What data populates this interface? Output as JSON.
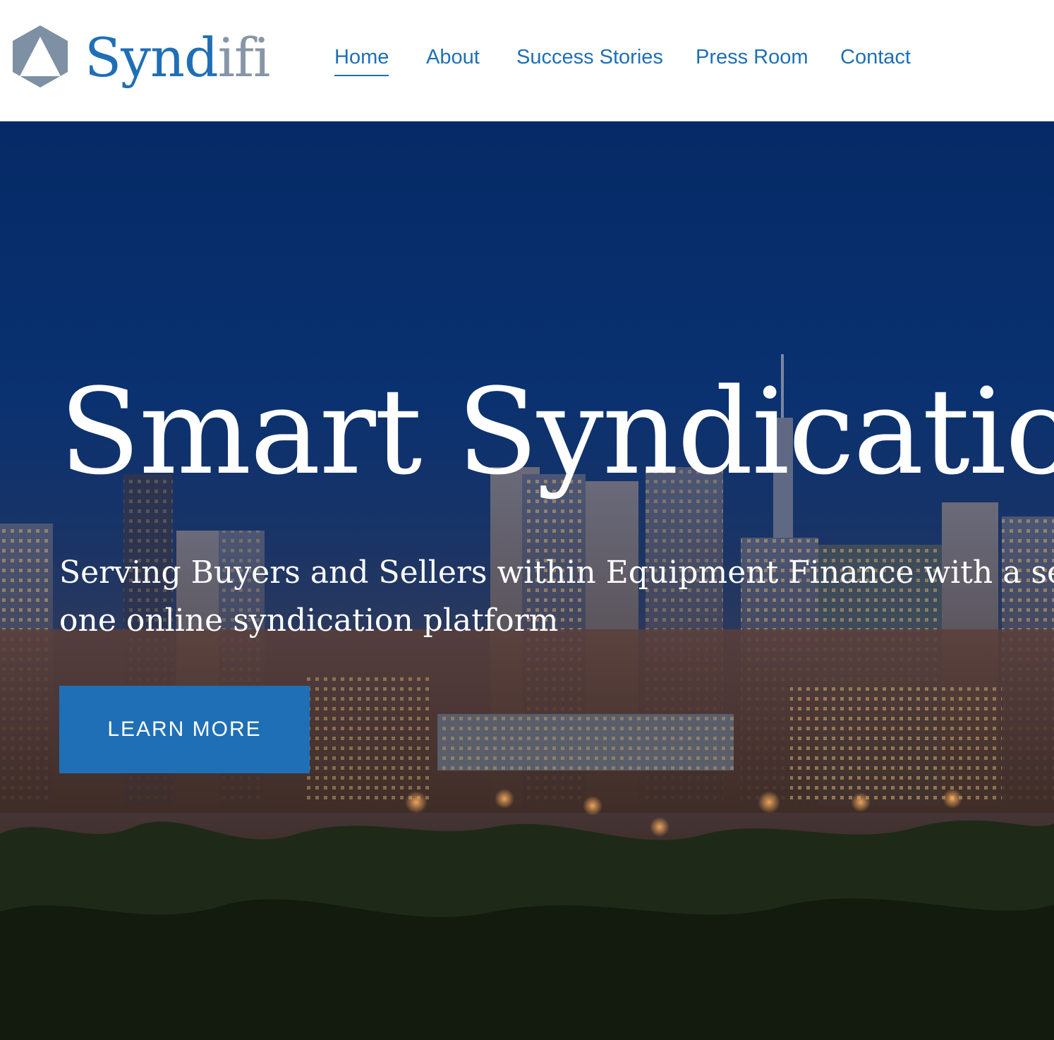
{
  "brand": {
    "name_part1": "Synd",
    "name_part2": "ifi",
    "logo_icon": "hexagon-triangle-logo-icon",
    "colors": {
      "primary": "#1f6fb6",
      "secondary": "#8796a6"
    }
  },
  "nav": {
    "items": [
      {
        "label": "Home",
        "active": true
      },
      {
        "label": "About"
      },
      {
        "label": "Success Stories"
      },
      {
        "label": "Press Room"
      },
      {
        "label": "Contact"
      }
    ]
  },
  "hero": {
    "title": "Smart Syndication",
    "subtitle_line1": "Serving Buyers and Sellers within Equipment Finance with a secure, a",
    "subtitle_line2": "one online syndication platform",
    "cta_label": "LEARN MORE",
    "background": "night city skyline with trees",
    "colors": {
      "overlay": "#052a66",
      "cta": "#1f6fb6"
    }
  }
}
